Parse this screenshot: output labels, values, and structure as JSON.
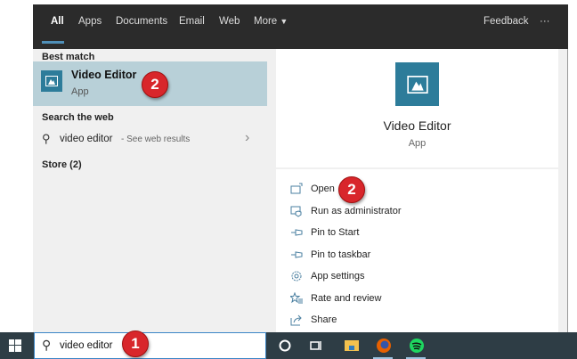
{
  "header": {
    "tabs": [
      "All",
      "Apps",
      "Documents",
      "Email",
      "Web",
      "More"
    ],
    "feedback": "Feedback",
    "more_options": "···"
  },
  "left": {
    "best_match": "Best match",
    "result": {
      "title": "Video Editor",
      "subtitle": "App"
    },
    "search_web": "Search the web",
    "web_query": "video editor",
    "web_hint": " - See web results",
    "store": "Store (2)"
  },
  "right": {
    "title": "Video Editor",
    "subtitle": "App",
    "actions": [
      "Open",
      "Run as administrator",
      "Pin to Start",
      "Pin to taskbar",
      "App settings",
      "Rate and review",
      "Share"
    ]
  },
  "taskbar": {
    "search_value": "video editor"
  },
  "badges": {
    "one": "1",
    "two": "2"
  },
  "colors": {
    "accent": "#2d7c9a",
    "selected": "#b8d0d8",
    "badge": "#d8262b"
  }
}
